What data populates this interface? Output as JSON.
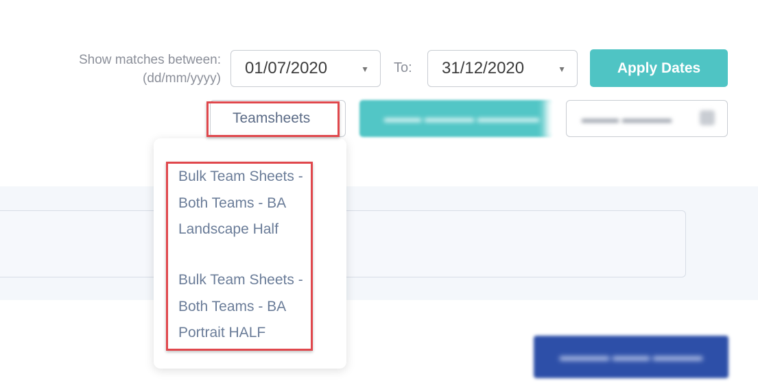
{
  "filters": {
    "label_line1": "Show matches between:",
    "label_line2": "(dd/mm/yyyy)",
    "from_date": "01/07/2020",
    "to_label": "To:",
    "to_date": "31/12/2020",
    "apply_label": "Apply Dates"
  },
  "toolbar": {
    "teamsheets_label": "Teamsheets"
  },
  "teamsheets_menu": {
    "items": [
      {
        "line1": "Bulk Team Sheets -",
        "line2": "Both Teams - BA",
        "line3": "Landscape Half"
      },
      {
        "line1": "Bulk Team Sheets -",
        "line2": "Both Teams - BA",
        "line3": "Portrait HALF"
      }
    ]
  },
  "colors": {
    "accent_teal": "#4fc4c4",
    "highlight_red": "#e0474c",
    "menu_text": "#6a7c98",
    "primary_blue": "#2d4fa8"
  }
}
